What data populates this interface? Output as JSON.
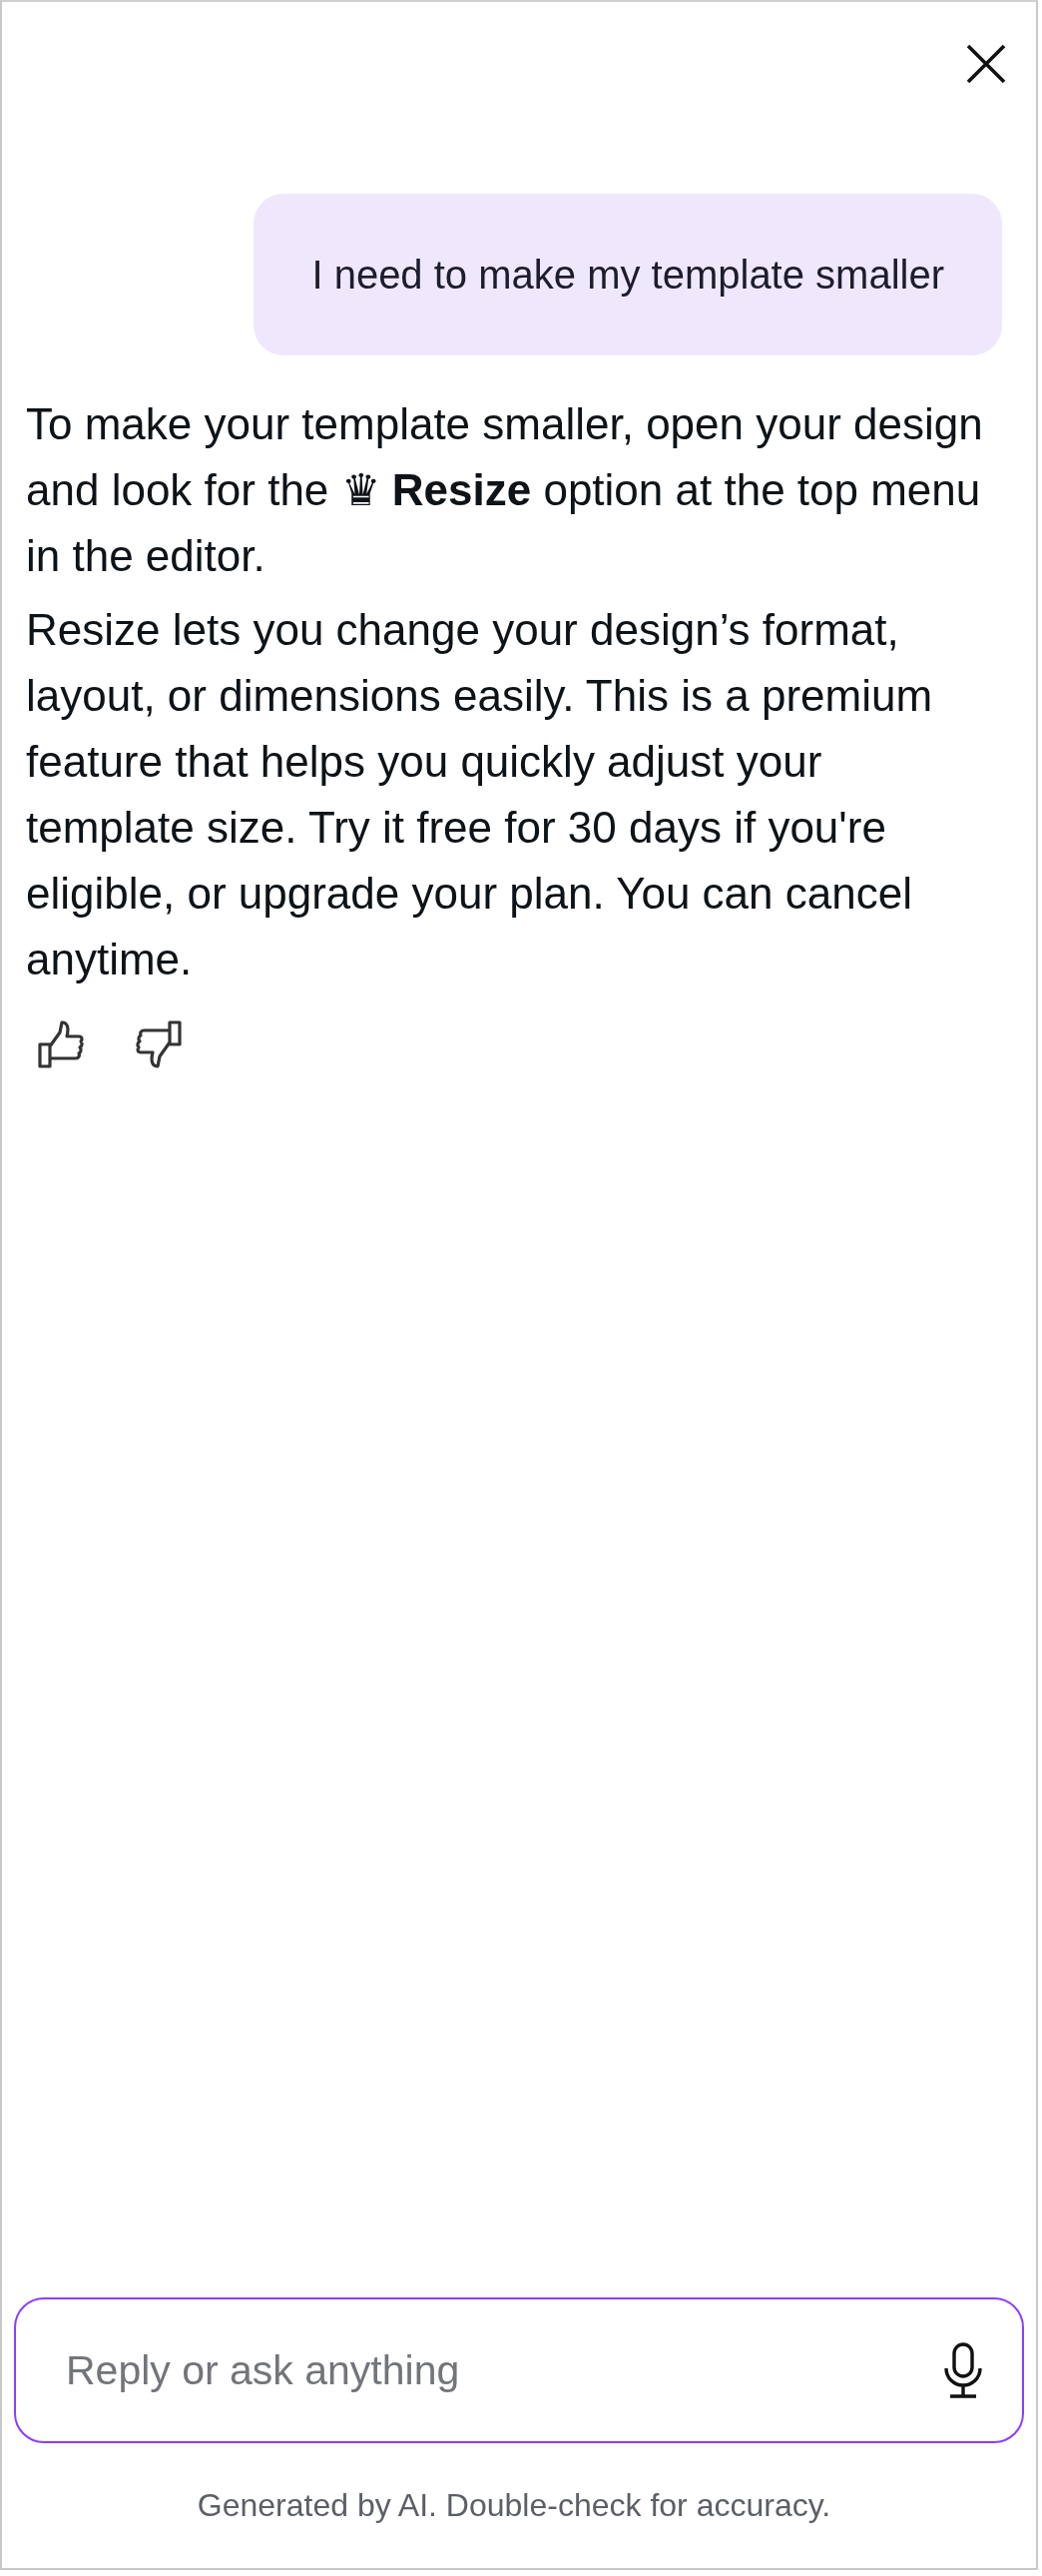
{
  "user_message": "I need to make my template smaller",
  "assistant_paragraphs": [
    "To make your template smaller, open your design and look for the ♛ **Resize** option at the top menu in the editor.",
    "Resize lets you change your design’s format, layout, or dimensions easily. This is a premium feature that helps you quickly adjust your template size. Try it free for 30 days if you're eligible, or upgrade your plan. You can cancel anytime."
  ],
  "composer": {
    "placeholder": "Reply or ask anything"
  },
  "disclaimer": "Generated by AI. Double-check for accuracy."
}
